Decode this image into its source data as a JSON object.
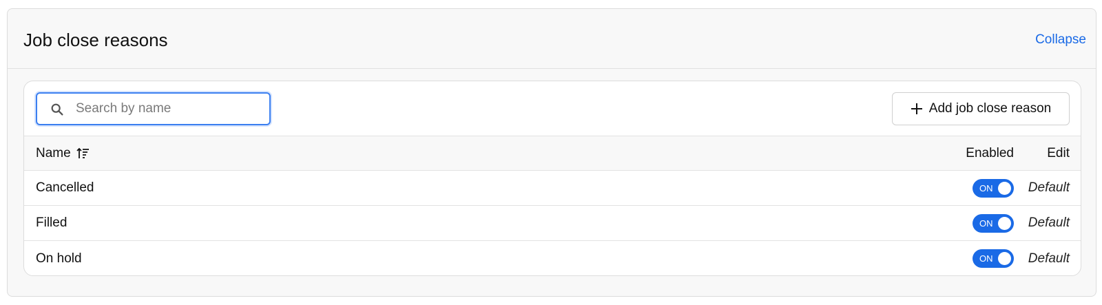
{
  "header": {
    "title": "Job close reasons",
    "collapse_label": "Collapse"
  },
  "toolbar": {
    "search_placeholder": "Search by name",
    "search_value": "",
    "add_label": "Add job close reason"
  },
  "table": {
    "columns": {
      "name": "Name",
      "enabled": "Enabled",
      "edit": "Edit"
    },
    "sort": "ascending",
    "rows": [
      {
        "name": "Cancelled",
        "enabled": true,
        "toggle_label": "ON",
        "edit": "Default"
      },
      {
        "name": "Filled",
        "enabled": true,
        "toggle_label": "ON",
        "edit": "Default"
      },
      {
        "name": "On hold",
        "enabled": true,
        "toggle_label": "ON",
        "edit": "Default"
      }
    ]
  },
  "icons": {
    "search": "search-icon",
    "plus": "plus-icon",
    "sort": "sort-ascending-icon"
  },
  "colors": {
    "accent": "#1a6ae6",
    "toggle_on": "#1a6ae6",
    "focus_ring": "#3b7ff0"
  }
}
